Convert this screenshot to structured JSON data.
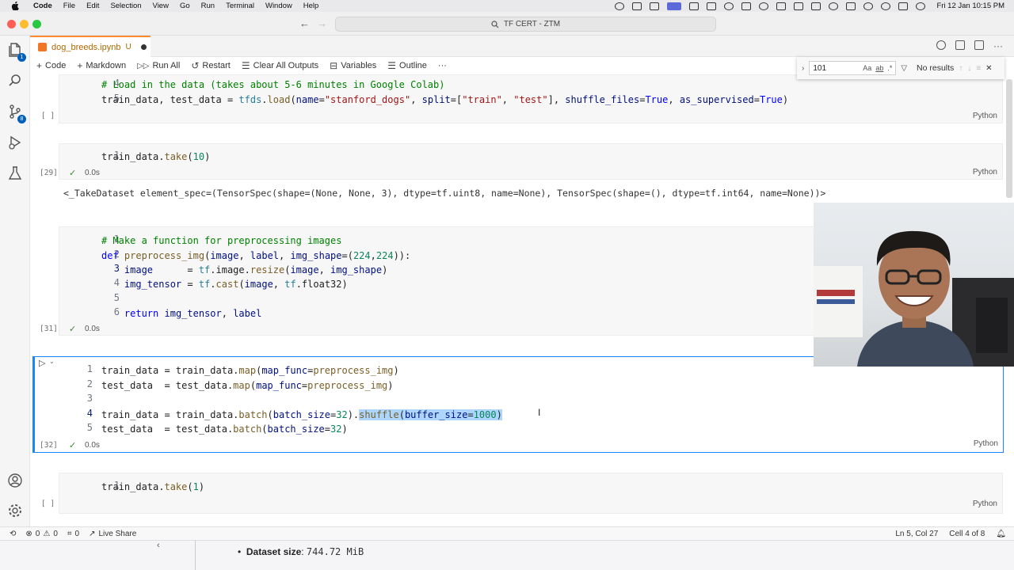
{
  "menubar": {
    "app": "Code",
    "items": [
      "File",
      "Edit",
      "Selection",
      "View",
      "Go",
      "Run",
      "Terminal",
      "Window",
      "Help"
    ],
    "clock": "Fri 12 Jan  10:15 PM"
  },
  "titlebar": {
    "search": "TF CERT - ZTM"
  },
  "tab": {
    "filename": "dog_breeds.ipynb",
    "status": "U"
  },
  "toolbar": {
    "code": "Code",
    "markdown": "Markdown",
    "run_all": "Run All",
    "restart": "Restart",
    "clear_outputs": "Clear All Outputs",
    "variables": "Variables",
    "outline": "Outline",
    "more": "···"
  },
  "find": {
    "query": "101",
    "match_case": "Aa",
    "whole_word": "ab",
    "regex": ".*",
    "result": "No results"
  },
  "cells": [
    {
      "exec": "[ ]",
      "lang": "Python",
      "lines": [
        {
          "n": "4",
          "text": "# Load in the data (takes about 5-6 minutes in Google Colab)"
        },
        {
          "n": "5",
          "text": "train_data, test_data = tfds.load(name=\"stanford_dogs\", split=[\"train\", \"test\"], shuffle_files=True, as_supervised=True)"
        }
      ]
    },
    {
      "exec": "[29]",
      "time": "0.0s",
      "lang": "Python",
      "lines": [
        {
          "n": "1",
          "text": "train_data.take(10)"
        }
      ],
      "output": "<_TakeDataset element_spec=(TensorSpec(shape=(None, None, 3), dtype=tf.uint8, name=None), TensorSpec(shape=(), dtype=tf.int64, name=None))>"
    },
    {
      "exec": "[31]",
      "time": "0.0s",
      "lang": "Python",
      "lines": [
        {
          "n": "1",
          "text": "# Make a function for preprocessing images"
        },
        {
          "n": "2",
          "text": "def preprocess_img(image, label, img_shape=(224,224)):"
        },
        {
          "n": "3",
          "text": "    image      = tf.image.resize(image, img_shape)"
        },
        {
          "n": "4",
          "text": "    img_tensor = tf.cast(image, tf.float32)"
        },
        {
          "n": "5",
          "text": ""
        },
        {
          "n": "6",
          "text": "    return img_tensor, label"
        }
      ]
    },
    {
      "exec": "[32]",
      "time": "0.0s",
      "lang": "Python",
      "lines": [
        {
          "n": "1",
          "text": "train_data = train_data.map(map_func=preprocess_img)"
        },
        {
          "n": "2",
          "text": "test_data  = test_data.map(map_func=preprocess_img)"
        },
        {
          "n": "3",
          "text": ""
        },
        {
          "n": "4",
          "text": "train_data = train_data.batch(batch_size=32).shuffle(buffer_size=1000)"
        },
        {
          "n": "5",
          "text": "test_data  = test_data.batch(batch_size=32)"
        }
      ]
    },
    {
      "exec": "[ ]",
      "lang": "Python",
      "lines": [
        {
          "n": "1",
          "text": "train_data.take(1)"
        }
      ]
    }
  ],
  "statusbar": {
    "errors": "0",
    "warnings": "0",
    "ports": "0",
    "liveshare": "Live Share",
    "position": "Ln 5, Col 27",
    "cell": "Cell 4 of 8"
  },
  "behind": {
    "label": "Dataset size",
    "value": "744.72 MiB"
  },
  "colors": {
    "accent": "#1a85ff",
    "tab_modified": "#ff8c32",
    "keyword": "#0000ff",
    "comment": "#008000",
    "string": "#a31515",
    "number": "#098658"
  }
}
